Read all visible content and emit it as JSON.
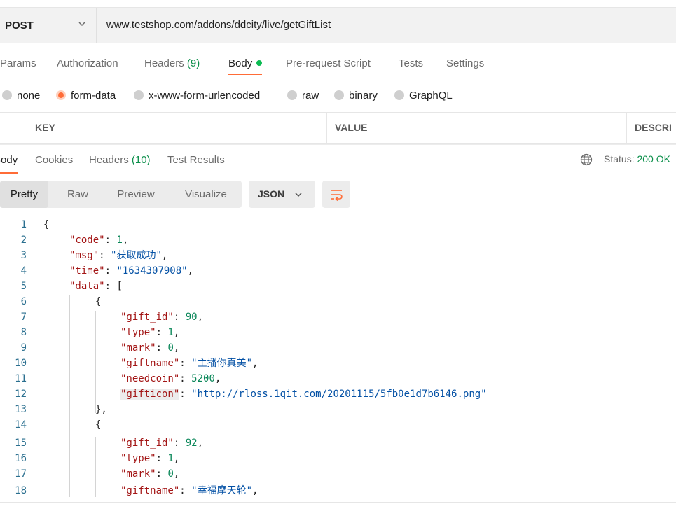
{
  "request": {
    "method": "POST",
    "url": "www.testshop.com/addons/ddcity/live/getGiftList"
  },
  "request_tabs": {
    "params": "Params",
    "authorization": "Authorization",
    "headers": "Headers",
    "headers_count": "(9)",
    "body": "Body",
    "prerequest": "Pre-request Script",
    "tests": "Tests",
    "settings": "Settings"
  },
  "body_types": {
    "none": "none",
    "form_data": "form-data",
    "urlencoded": "x-www-form-urlencoded",
    "raw": "raw",
    "binary": "binary",
    "graphql": "GraphQL",
    "selected": "form-data"
  },
  "kv_table": {
    "key": "KEY",
    "value": "VALUE",
    "description": "DESCRI"
  },
  "response_tabs": {
    "body": "Body",
    "cookies": "Cookies",
    "headers": "Headers",
    "headers_count": "(10)",
    "test_results": "Test Results"
  },
  "status": {
    "label": "Status:",
    "value": "200 OK"
  },
  "view_modes": {
    "pretty": "Pretty",
    "raw": "Raw",
    "preview": "Preview",
    "visualize": "Visualize"
  },
  "format": "JSON",
  "code": {
    "line_numbers": [
      "1",
      "2",
      "3",
      "4",
      "5",
      "6",
      "7",
      "8",
      "9",
      "10",
      "11",
      "12",
      "13",
      "14",
      "15",
      "16",
      "17",
      "18"
    ],
    "lines": {
      "l1": "{",
      "l2k": "\"code\"",
      "l2v": "1",
      "l3k": "\"msg\"",
      "l3v": "\"获取成功\"",
      "l4k": "\"time\"",
      "l4v": "\"1634307908\"",
      "l5k": "\"data\"",
      "l5v": "[",
      "l6": "{",
      "l7k": "\"gift_id\"",
      "l7v": "90",
      "l8k": "\"type\"",
      "l8v": "1",
      "l9k": "\"mark\"",
      "l9v": "0",
      "l10k": "\"giftname\"",
      "l10v": "\"主播你真美\"",
      "l11k": "\"needcoin\"",
      "l11v": "5200",
      "l12k": "\"gifticon\"",
      "l12v": "http://rloss.1qit.com/20201115/5fb0e1d7b6146.png",
      "l13": "},",
      "l14": "{",
      "l15k": "\"gift_id\"",
      "l15v": "92",
      "l16k": "\"type\"",
      "l16v": "1",
      "l17k": "\"mark\"",
      "l17v": "0",
      "l18k": "\"giftname\"",
      "l18v": "\"幸福摩天轮\""
    }
  },
  "colors": {
    "accent": "#ff6c37",
    "success": "#0b8f4a",
    "json_key": "#a31515",
    "json_string": "#0451a5",
    "json_number": "#098658"
  }
}
